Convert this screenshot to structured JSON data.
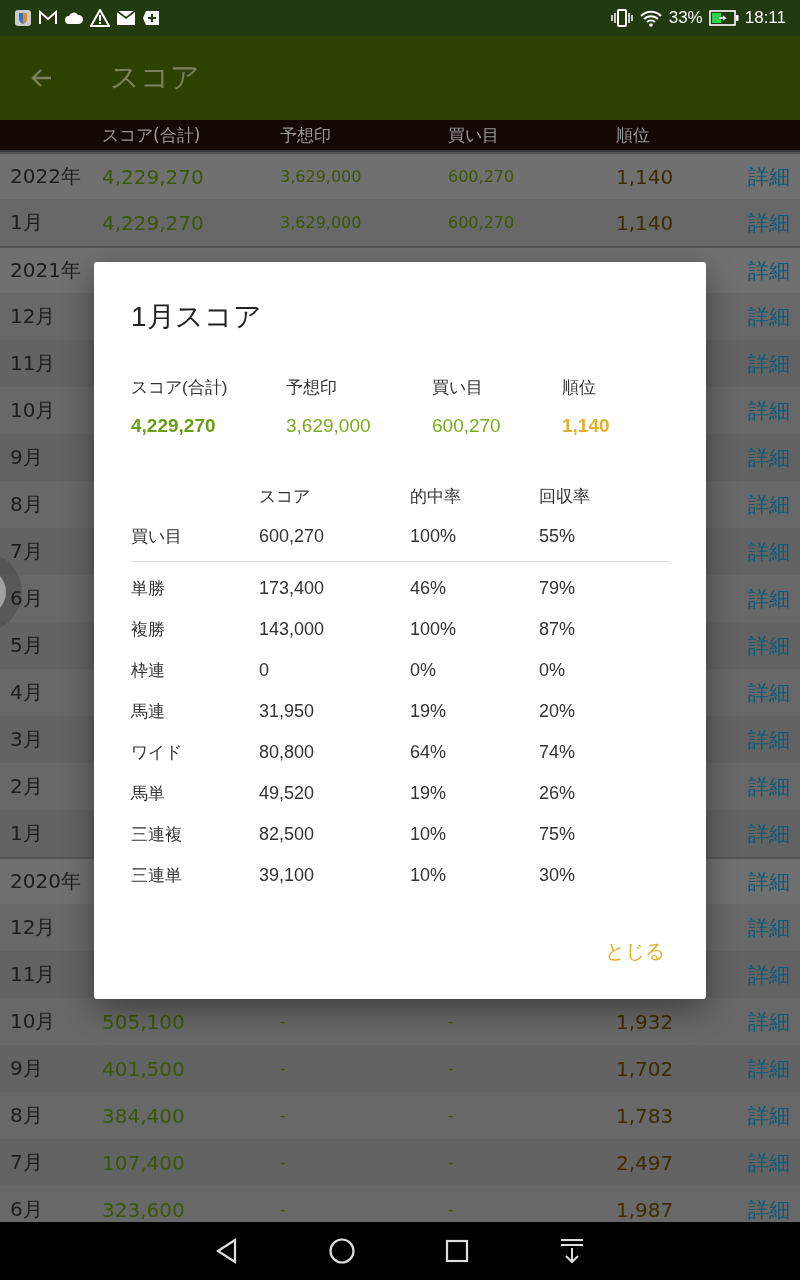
{
  "status_bar": {
    "battery": "33%",
    "time": "18:11"
  },
  "app_bar": {
    "title": "スコア"
  },
  "table": {
    "columns": [
      "スコア(合計)",
      "予想印",
      "買い目",
      "順位"
    ],
    "rows": [
      {
        "kind": "year",
        "label": "2022年",
        "score": "4,229,270",
        "marks": "3,629,000",
        "bets": "600,270",
        "rank": "1,140",
        "detail": "詳細"
      },
      {
        "kind": "month",
        "label": "1月",
        "score": "4,229,270",
        "marks": "3,629,000",
        "bets": "600,270",
        "rank": "1,140",
        "detail": "詳細"
      },
      {
        "kind": "year",
        "label": "2021年",
        "detail": "詳細"
      },
      {
        "kind": "month",
        "label": "12月",
        "detail": "詳細"
      },
      {
        "kind": "month",
        "label": "11月",
        "detail": "詳細"
      },
      {
        "kind": "month",
        "label": "10月",
        "detail": "詳細"
      },
      {
        "kind": "month",
        "label": "9月",
        "detail": "詳細"
      },
      {
        "kind": "month",
        "label": "8月",
        "detail": "詳細"
      },
      {
        "kind": "month",
        "label": "7月",
        "detail": "詳細"
      },
      {
        "kind": "month",
        "label": "6月",
        "detail": "詳細"
      },
      {
        "kind": "month",
        "label": "5月",
        "detail": "詳細"
      },
      {
        "kind": "month",
        "label": "4月",
        "detail": "詳細"
      },
      {
        "kind": "month",
        "label": "3月",
        "detail": "詳細"
      },
      {
        "kind": "month",
        "label": "2月",
        "detail": "詳細"
      },
      {
        "kind": "month",
        "label": "1月",
        "detail": "詳細"
      },
      {
        "kind": "year",
        "label": "2020年",
        "detail": "詳細"
      },
      {
        "kind": "month",
        "label": "12月",
        "detail": "詳細"
      },
      {
        "kind": "month",
        "label": "11月",
        "detail": "詳細"
      },
      {
        "kind": "month",
        "label": "10月",
        "score": "505,100",
        "marks": "-",
        "bets": "-",
        "rank": "1,932",
        "detail": "詳細"
      },
      {
        "kind": "month",
        "label": "9月",
        "score": "401,500",
        "marks": "-",
        "bets": "-",
        "rank": "1,702",
        "detail": "詳細"
      },
      {
        "kind": "month",
        "label": "8月",
        "score": "384,400",
        "marks": "-",
        "bets": "-",
        "rank": "1,783",
        "detail": "詳細"
      },
      {
        "kind": "month",
        "label": "7月",
        "score": "107,400",
        "marks": "-",
        "bets": "-",
        "rank": "2,497",
        "detail": "詳細"
      },
      {
        "kind": "month",
        "label": "6月",
        "score": "323,600",
        "marks": "-",
        "bets": "-",
        "rank": "1,987",
        "detail": "詳細"
      }
    ]
  },
  "dialog": {
    "title": "1月スコア",
    "summary": [
      {
        "label": "スコア(合計)",
        "value": "4,229,270",
        "kind": "emphasis",
        "color": "#6a9e12"
      },
      {
        "label": "予想印",
        "value": "3,629,000",
        "kind": "plain",
        "color": "#7aac1c"
      },
      {
        "label": "買い目",
        "value": "600,270",
        "kind": "plain",
        "color": "#7aac1c"
      },
      {
        "label": "順位",
        "value": "1,140",
        "kind": "emphasis",
        "color": "#e4ae2a"
      }
    ],
    "columns": [
      "スコア",
      "的中率",
      "回収率"
    ],
    "rows": [
      {
        "kind": "total",
        "label": "買い目",
        "score": "600,270",
        "hit_rate": "100%",
        "return_rate": "55%"
      },
      {
        "kind": "bet",
        "label": "単勝",
        "score": "173,400",
        "hit_rate": "46%",
        "return_rate": "79%"
      },
      {
        "kind": "bet",
        "label": "複勝",
        "score": "143,000",
        "hit_rate": "100%",
        "return_rate": "87%"
      },
      {
        "kind": "bet",
        "label": "枠連",
        "score": "0",
        "hit_rate": "0%",
        "return_rate": "0%"
      },
      {
        "kind": "bet",
        "label": "馬連",
        "score": "31,950",
        "hit_rate": "19%",
        "return_rate": "20%"
      },
      {
        "kind": "bet",
        "label": "ワイド",
        "score": "80,800",
        "hit_rate": "64%",
        "return_rate": "74%"
      },
      {
        "kind": "bet",
        "label": "馬単",
        "score": "49,520",
        "hit_rate": "19%",
        "return_rate": "26%"
      },
      {
        "kind": "bet",
        "label": "三連複",
        "score": "82,500",
        "hit_rate": "10%",
        "return_rate": "75%"
      },
      {
        "kind": "bet",
        "label": "三連単",
        "score": "39,100",
        "hit_rate": "10%",
        "return_rate": "30%"
      }
    ],
    "close": "とじる"
  }
}
